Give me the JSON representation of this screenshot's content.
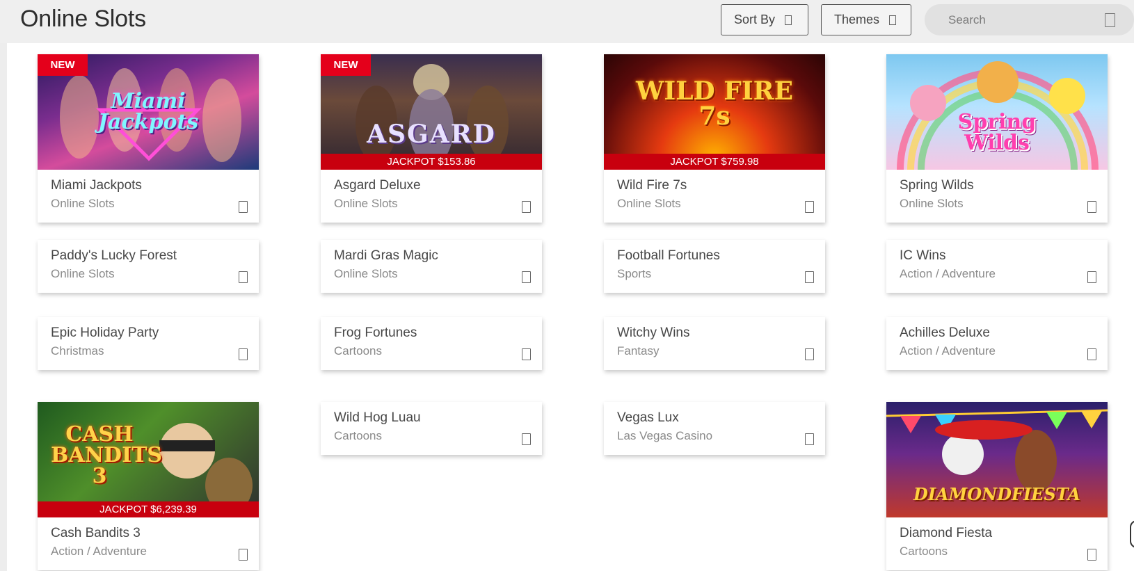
{
  "header": {
    "title": "Online Slots",
    "sort_label": "Sort By",
    "themes_label": "Themes",
    "search_placeholder": "Search"
  },
  "games": [
    {
      "name": "Miami Jackpots",
      "category": "Online Slots",
      "badge": "NEW",
      "jackpot": "",
      "logo": "Miami Jackpots"
    },
    {
      "name": "Asgard Deluxe",
      "category": "Online Slots",
      "badge": "NEW",
      "jackpot": "JACKPOT $153.86",
      "logo": "ASGARD"
    },
    {
      "name": "Wild Fire 7s",
      "category": "Online Slots",
      "badge": "",
      "jackpot": "JACKPOT $759.98",
      "logo": "WILD FIRE 7s"
    },
    {
      "name": "Spring Wilds",
      "category": "Online Slots",
      "badge": "",
      "jackpot": "",
      "logo": "Spring Wilds"
    },
    {
      "name": "Paddy's Lucky Forest",
      "category": "Online Slots"
    },
    {
      "name": "Mardi Gras Magic",
      "category": "Online Slots"
    },
    {
      "name": "Football Fortunes",
      "category": "Sports"
    },
    {
      "name": "IC Wins",
      "category": "Action / Adventure"
    },
    {
      "name": "Epic Holiday Party",
      "category": "Christmas"
    },
    {
      "name": "Frog Fortunes",
      "category": "Cartoons"
    },
    {
      "name": "Witchy Wins",
      "category": "Fantasy"
    },
    {
      "name": "Achilles Deluxe",
      "category": "Action / Adventure"
    },
    {
      "name": "Cash Bandits 3",
      "category": "Action / Adventure",
      "badge": "",
      "jackpot": "JACKPOT $6,239.39",
      "logo": "CASH BANDITS 3"
    },
    {
      "name": "Wild Hog Luau",
      "category": "Cartoons"
    },
    {
      "name": "Vegas Lux",
      "category": "Las Vegas Casino"
    },
    {
      "name": "Diamond Fiesta",
      "category": "Cartoons",
      "badge": "",
      "jackpot": "",
      "logo": "DIAMONDFIESTA"
    }
  ],
  "colors": {
    "badge": "#e4001b",
    "jackpot": "#c8000e",
    "text": "#474747",
    "muted": "#8a8a8a"
  }
}
